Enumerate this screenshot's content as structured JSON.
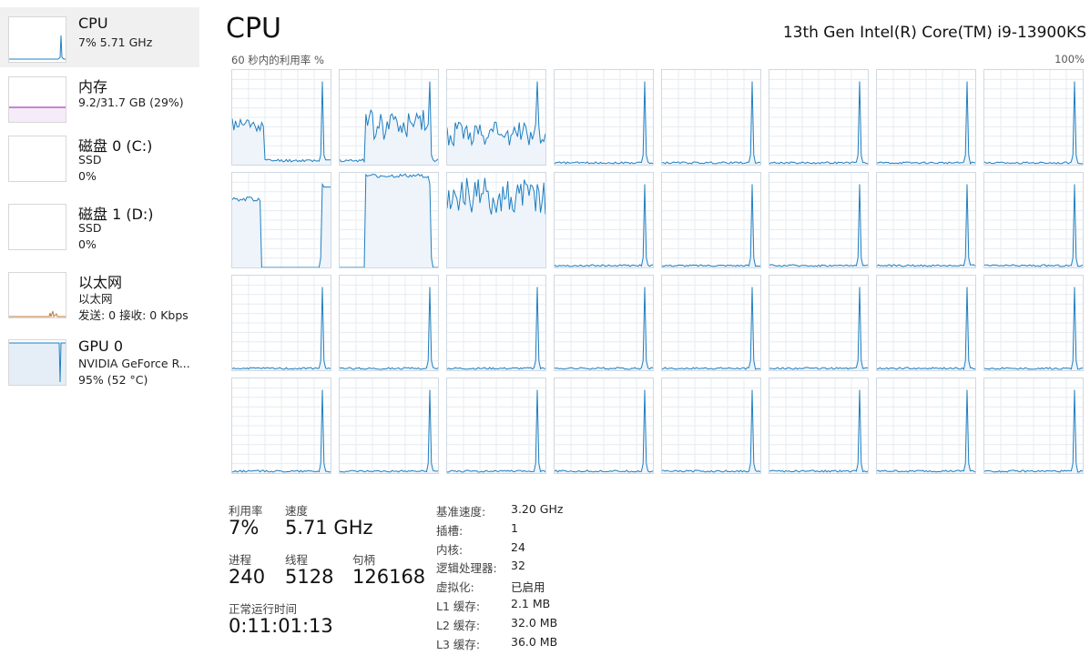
{
  "sidebar": {
    "items": [
      {
        "title": "CPU",
        "line1": "7% 5.71 GHz",
        "line2": ""
      },
      {
        "title": "内存",
        "line1": "9.2/31.7 GB (29%)",
        "line2": ""
      },
      {
        "title": "磁盘 0 (C:)",
        "line1": "SSD",
        "line2": "0%"
      },
      {
        "title": "磁盘 1 (D:)",
        "line1": "SSD",
        "line2": "0%"
      },
      {
        "title": "以太网",
        "line1": "以太网",
        "line2": "发送: 0 接收: 0 Kbps"
      },
      {
        "title": "GPU 0",
        "line1": "NVIDIA GeForce R...",
        "line2": "95% (52 °C)"
      }
    ]
  },
  "main": {
    "title": "CPU",
    "model": "13th Gen Intel(R) Core(TM) i9-13900KS",
    "axis_left": "60 秒内的利用率 %",
    "axis_right": "100%"
  },
  "stats": {
    "utilization_label": "利用率",
    "utilization_value": "7%",
    "speed_label": "速度",
    "speed_value": "5.71 GHz",
    "processes_label": "进程",
    "processes_value": "240",
    "threads_label": "线程",
    "threads_value": "5128",
    "handles_label": "句柄",
    "handles_value": "126168",
    "uptime_label": "正常运行时间",
    "uptime_value": "0:11:01:13"
  },
  "specs": [
    {
      "label": "基准速度:",
      "value": "3.20 GHz"
    },
    {
      "label": "插槽:",
      "value": "1"
    },
    {
      "label": "内核:",
      "value": "24"
    },
    {
      "label": "逻辑处理器:",
      "value": "32"
    },
    {
      "label": "虚拟化:",
      "value": "已启用"
    },
    {
      "label": "L1 缓存:",
      "value": "2.1 MB"
    },
    {
      "label": "L2 缓存:",
      "value": "32.0 MB"
    },
    {
      "label": "L3 缓存:",
      "value": "36.0 MB"
    }
  ],
  "colors": {
    "cpu_line": "#1f7fc0",
    "cpu_fill": "#eef4fa",
    "grid_line": "#e6ecf2",
    "memory_line": "#a445b8",
    "ethernet_line": "#c07a3a",
    "sidebar_active_bg": "#f0f0f0"
  },
  "core_count": 32
}
